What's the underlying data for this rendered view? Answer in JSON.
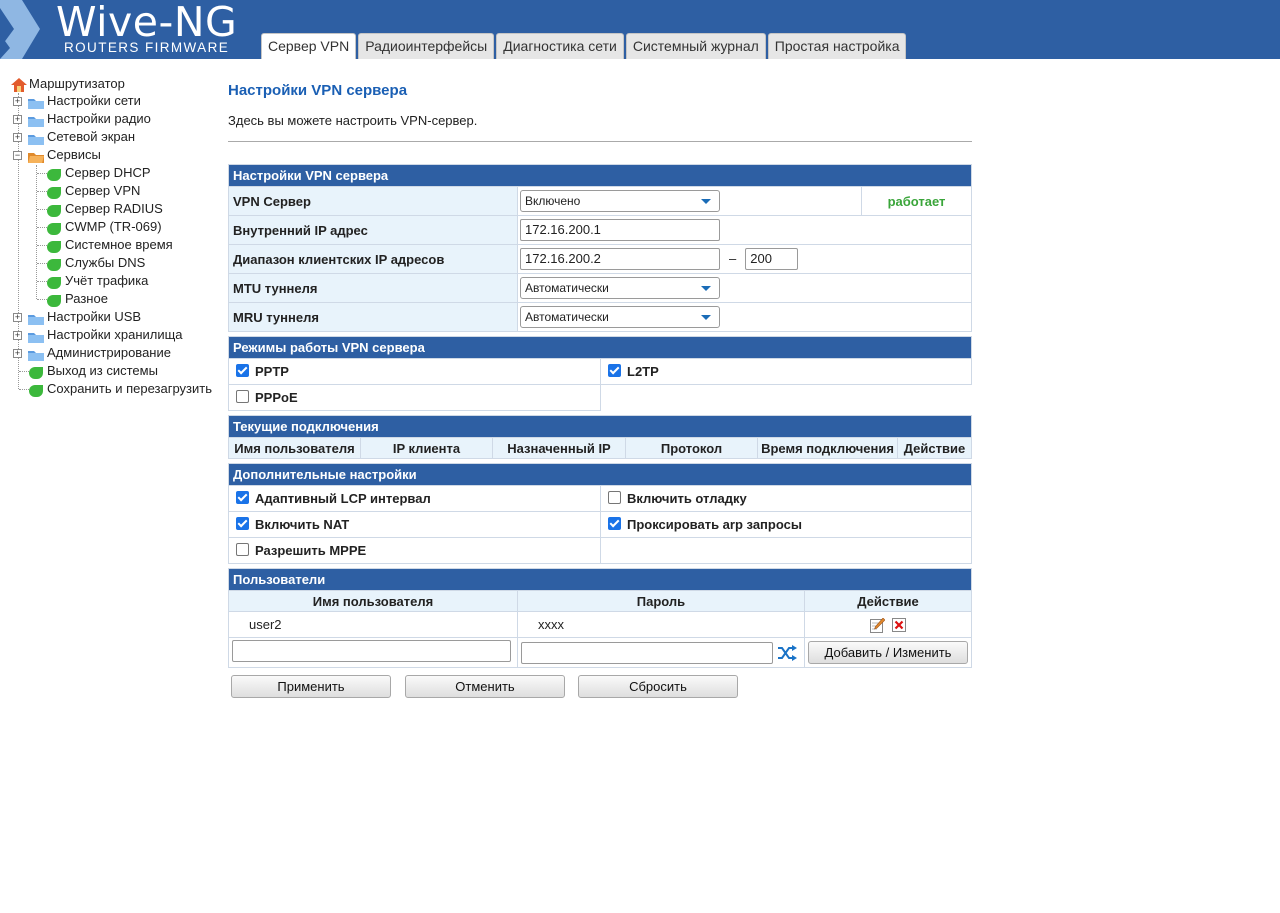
{
  "header": {
    "logo_title": "Wive-NG",
    "logo_subtitle": "ROUTERS FIRMWARE",
    "tabs": [
      "Сервер VPN",
      "Радиоинтерфейсы",
      "Диагностика сети",
      "Системный журнал",
      "Простая настройка"
    ],
    "active_tab": "Сервер VPN"
  },
  "sidebar": {
    "root": "Маршрутизатор",
    "items": [
      "Настройки сети",
      "Настройки радио",
      "Сетевой экран",
      "Сервисы",
      "Сервер DHCP",
      "Сервер VPN",
      "Сервер RADIUS",
      "CWMP (TR-069)",
      "Системное время",
      "Службы DNS",
      "Учёт трафика",
      "Разное",
      "Настройки USB",
      "Настройки хранилища",
      "Администрирование",
      "Выход из системы",
      "Сохранить и перезагрузить"
    ]
  },
  "page": {
    "title": "Настройки VPN сервера",
    "description": "Здесь вы можете настроить VPN-сервер."
  },
  "vpn_settings": {
    "header": "Настройки VPN сервера",
    "server_label": "VPN Сервер",
    "server_value": "Включено",
    "server_status": "работает",
    "internal_ip_label": "Внутренний IP адрес",
    "internal_ip_value": "172.16.200.1",
    "range_label": "Диапазон клиентских IP адресов",
    "range_start": "172.16.200.2",
    "range_sep": "–",
    "range_end": "200",
    "mtu_label": "MTU туннеля",
    "mtu_value": "Автоматически",
    "mru_label": "MRU туннеля",
    "mru_value": "Автоматически"
  },
  "modes": {
    "header": "Режимы работы VPN сервера",
    "pptp": "PPTP",
    "pptp_checked": true,
    "l2tp": "L2TP",
    "l2tp_checked": true,
    "pppoe": "PPPoE",
    "pppoe_checked": false
  },
  "connections": {
    "header": "Текущие подключения",
    "columns": [
      "Имя пользователя",
      "IP клиента",
      "Назначенный IP",
      "Протокол",
      "Время подключения",
      "Действие"
    ]
  },
  "advanced": {
    "header": "Дополнительные настройки",
    "adaptive_lcp": "Адаптивный LCP интервал",
    "adaptive_lcp_checked": true,
    "debug": "Включить отладку",
    "debug_checked": false,
    "nat": "Включить NAT",
    "nat_checked": true,
    "proxy_arp": "Проксировать arp запросы",
    "proxy_arp_checked": true,
    "mppe": "Разрешить MPPE",
    "mppe_checked": false
  },
  "users": {
    "header": "Пользователи",
    "col_user": "Имя пользователя",
    "col_password": "Пароль",
    "col_action": "Действие",
    "rows": [
      {
        "user": "user2",
        "password": "xxxx"
      }
    ],
    "add_button": "Добавить / Изменить"
  },
  "buttons": {
    "apply": "Применить",
    "cancel": "Отменить",
    "reset": "Сбросить"
  },
  "colors": {
    "header_bg": "#2e5fa3",
    "title_blue": "#1a5fb4",
    "status_green": "#3aa53a",
    "label_bg": "#e8f3fb"
  }
}
